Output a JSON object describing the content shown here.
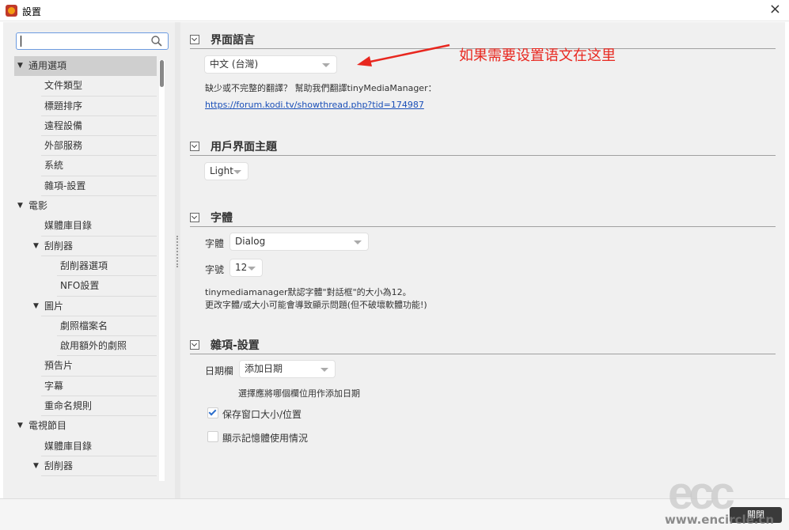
{
  "window": {
    "title": "設置",
    "close_label": "×"
  },
  "search": {
    "placeholder": ""
  },
  "tree": [
    {
      "label": "通用選項",
      "level": 0,
      "expanded": true,
      "selected": true
    },
    {
      "label": "文件類型",
      "level": 1
    },
    {
      "label": "標題排序",
      "level": 1
    },
    {
      "label": "遠程設備",
      "level": 1
    },
    {
      "label": "外部服務",
      "level": 1
    },
    {
      "label": "系統",
      "level": 1
    },
    {
      "label": "雜項-設置",
      "level": 1
    },
    {
      "label": "電影",
      "level": 0,
      "expanded": true
    },
    {
      "label": "媒體庫目錄",
      "level": 1
    },
    {
      "label": "刮削器",
      "level": 1,
      "expanded": true
    },
    {
      "label": "刮削器選項",
      "level": 2
    },
    {
      "label": "NFO設置",
      "level": 2
    },
    {
      "label": "圖片",
      "level": 1,
      "expanded": true
    },
    {
      "label": "劇照檔案名",
      "level": 2
    },
    {
      "label": "啟用額外的劇照",
      "level": 2
    },
    {
      "label": "預告片",
      "level": 1
    },
    {
      "label": "字幕",
      "level": 1
    },
    {
      "label": "重命名規則",
      "level": 1
    },
    {
      "label": "電視節目",
      "level": 0,
      "expanded": true
    },
    {
      "label": "媒體庫目錄",
      "level": 1
    },
    {
      "label": "刮削器",
      "level": 1,
      "expanded": true
    }
  ],
  "sections": {
    "language": {
      "title": "界面語言",
      "selected": "中文 (台灣)",
      "help_text": "缺少或不完整的翻譯？ 幫助我們翻譯tinyMediaManager：",
      "link": "https://forum.kodi.tv/showthread.php?tid=174987"
    },
    "theme": {
      "title": "用戶界面主題",
      "selected": "Light"
    },
    "font": {
      "title": "字體",
      "font_label": "字體",
      "font_value": "Dialog",
      "size_label": "字號",
      "size_value": "12",
      "note1": "tinymediamanager默認字體\"對話框\"的大小為12。",
      "note2": "更改字體/或大小可能會導致顯示問題(但不破壞軟體功能!)"
    },
    "misc": {
      "title": "雜項-設置",
      "date_label": "日期欄",
      "date_value": "添加日期",
      "date_help": "選擇應將哪個欄位用作添加日期",
      "save_window": "保存窗口大小/位置",
      "save_window_checked": true,
      "show_memory": "顯示記憶體使用情況",
      "show_memory_checked": false
    }
  },
  "annotation": {
    "text": "如果需要设置语文在这里",
    "color": "#e8271f"
  },
  "footer": {
    "close_button": "關閉"
  },
  "watermark": {
    "logo": "ecc",
    "url": "www.encircle.cn"
  },
  "colors": {
    "selected_item": "#cfcfcf",
    "link": "#1a4fb8",
    "search_border": "#6c9be0"
  }
}
